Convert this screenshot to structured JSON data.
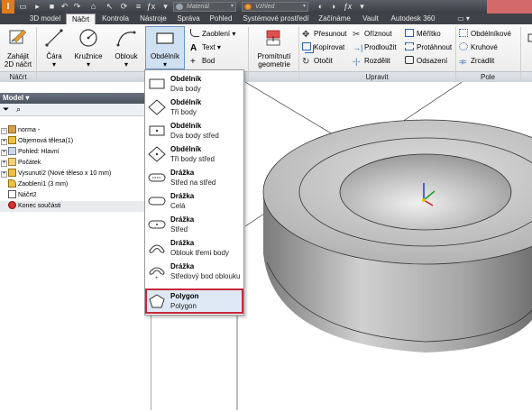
{
  "titlebar": {
    "app_icon": "I",
    "material_placeholder": "Materiál",
    "appearance_placeholder": "Vzhled",
    "icons": [
      "new-icon",
      "open-icon",
      "save-icon",
      "undo-icon",
      "redo-icon",
      "home-icon",
      "select-icon",
      "update-icon"
    ]
  },
  "tabs": [
    "3D model",
    "Náčrt",
    "Kontrola",
    "Nástroje",
    "Správa",
    "Pohled",
    "Systémové prostředí",
    "Začínáme",
    "Vault",
    "Autodesk 360"
  ],
  "active_tab": "Náčrt",
  "ribbon": {
    "start_sketch": {
      "line1": "Zahájit",
      "line2": "2D náčrt"
    },
    "line": "Čára",
    "circle": "Kružnice",
    "arc": "Oblouk",
    "rectangle": "Obdélník",
    "fillet": "Zaoblení",
    "text": "Text",
    "point": "Bod",
    "project_geometry": {
      "line1": "Promítnutí",
      "line2": "geometrie"
    },
    "modify": [
      "Přesunout",
      "Oříznout",
      "Měřítko",
      "Kopírovat",
      "Prodloužit",
      "Protáhnout",
      "Otočit",
      "Rozdělit",
      "Odsazení"
    ],
    "pattern": [
      "Obdélníkové",
      "Kruhové",
      "Zrcadlit"
    ],
    "panels": {
      "sketch": "Náčrt",
      "modify": "Upravit",
      "pattern": "Pole"
    }
  },
  "browser": {
    "title": "Model ▾",
    "items": [
      {
        "label": "norma -",
        "depth": 0,
        "icon": "part-icon"
      },
      {
        "label": "Objemová tělesa(1)",
        "depth": 1,
        "icon": "solid-bodies-icon"
      },
      {
        "label": "Pohled: Hlavní",
        "depth": 1,
        "icon": "view-icon"
      },
      {
        "label": "Počátek",
        "depth": 1,
        "icon": "origin-folder-icon"
      },
      {
        "label": "Vysunutí2 (Nové těleso x 10 mm)",
        "depth": 1,
        "icon": "extrude-icon"
      },
      {
        "label": "Zaoblení1 (3 mm)",
        "depth": 1,
        "icon": "fillet-feature-icon"
      },
      {
        "label": "Náčrt2",
        "depth": 1,
        "icon": "sketch-icon"
      },
      {
        "label": "Konec součásti",
        "depth": 1,
        "icon": "end-of-part-icon"
      }
    ]
  },
  "dropdown": [
    {
      "title": "Obdélník",
      "sub": "Dva body",
      "icon": "rect-two-point-icon"
    },
    {
      "title": "Obdélník",
      "sub": "Tři body",
      "icon": "rect-three-point-icon"
    },
    {
      "title": "Obdélník",
      "sub": "Dva body střed",
      "icon": "rect-two-point-center-icon"
    },
    {
      "title": "Obdélník",
      "sub": "Tři body střed",
      "icon": "rect-three-point-center-icon"
    },
    {
      "title": "Drážka",
      "sub": "Střed na střed",
      "icon": "slot-center-to-center-icon"
    },
    {
      "title": "Drážka",
      "sub": "Celá",
      "icon": "slot-overall-icon"
    },
    {
      "title": "Drážka",
      "sub": "Střed",
      "icon": "slot-center-point-icon"
    },
    {
      "title": "Drážka",
      "sub": "Oblouk třemi body",
      "icon": "slot-three-point-arc-icon"
    },
    {
      "title": "Drážka",
      "sub": "Středový bod oblouku",
      "icon": "slot-center-point-arc-icon"
    },
    {
      "title": "Polygon",
      "sub": "Polygon",
      "icon": "polygon-icon"
    }
  ],
  "highlighted_item": "Polygon",
  "colors": {
    "highlight_border": "#c7283b",
    "accent": "#e07a1a"
  }
}
